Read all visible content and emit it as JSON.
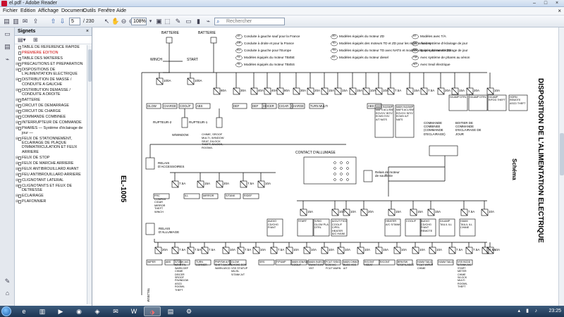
{
  "window": {
    "title": "el.pdf - Adobe Reader",
    "buttons": [
      "–",
      "□",
      "×"
    ]
  },
  "menu": {
    "items": [
      "Fichier",
      "Edition",
      "Affichage",
      "Document",
      "Outils",
      "Fenêtre",
      "Aide"
    ],
    "close": "×"
  },
  "toolbar": {
    "page_current": "5",
    "page_total": "/ 230",
    "zoom": "108%",
    "search_placeholder": "Rechercher"
  },
  "signets": {
    "title": "Signets",
    "close": "×",
    "items": [
      {
        "label": "TABLE DE REFERENCE RAPIDE",
        "selected": false,
        "expandable": false
      },
      {
        "label": "PREMIERE EDITION",
        "selected": true,
        "expandable": false
      },
      {
        "label": "TABLE DES MATIERES",
        "selected": false,
        "expandable": false
      },
      {
        "label": "PRECAUTIONS ET PREPARATION",
        "selected": false,
        "expandable": true
      },
      {
        "label": "DISPOSITIONS DE L'ALIMENTATION ELECTRIQUE",
        "selected": false,
        "expandable": true
      },
      {
        "label": "DISTRIBUTION DE MASSE / CONDUITE A GAUCHE",
        "selected": false,
        "expandable": true
      },
      {
        "label": "DISTRIBUTION DEMASSE / CONDUITE A DROITE",
        "selected": false,
        "expandable": true
      },
      {
        "label": "BATTERIE",
        "selected": false,
        "expandable": true
      },
      {
        "label": "CIRCUIT DE DEMARRAGE",
        "selected": false,
        "expandable": true
      },
      {
        "label": "CIRCUIT DE CHARGE",
        "selected": false,
        "expandable": true
      },
      {
        "label": "COMMANDE COMBINEE",
        "selected": false,
        "expandable": true
      },
      {
        "label": "INTERRUPTEUR DE COMMANDE",
        "selected": false,
        "expandable": true
      },
      {
        "label": "PHARES — Système d'éclairage de jour —",
        "selected": false,
        "expandable": true
      },
      {
        "label": "FEUX DE STATIONNEMENT, ECLAIRAGE DE PLAQUE D'IMMATRICULATION ET FEUX ARRIERE",
        "selected": false,
        "expandable": true
      },
      {
        "label": "FEUX DE STOP",
        "selected": false,
        "expandable": true
      },
      {
        "label": "FEUX DE MARCHE ARRIERE",
        "selected": false,
        "expandable": true
      },
      {
        "label": "FEUX ANTIBROUILLARD AVANT",
        "selected": false,
        "expandable": true
      },
      {
        "label": "FEU ANTIBROUILLARD ARRIERE",
        "selected": false,
        "expandable": true
      },
      {
        "label": "CLIGNOTANT LATERAL",
        "selected": false,
        "expandable": true
      },
      {
        "label": "CLIGNOTANTS ET FEUX DE DETRESSE",
        "selected": false,
        "expandable": true
      },
      {
        "label": "ECLAIRAGE",
        "selected": false,
        "expandable": true
      },
      {
        "label": "PLAFONNIER",
        "selected": false,
        "expandable": true
      }
    ]
  },
  "diagram": {
    "page_code": "EL-1005",
    "vertical_title": "DISPOSITION DE L'ALIMENTATION ELECTRIQUE",
    "vertical_subtitle": "Schéma",
    "small_code": "TEL201M",
    "battery_labels": [
      "BATTERIE",
      "BATTERIE"
    ],
    "winch": "WINCH",
    "start": "START",
    "legend": [
      {
        "code": "LE",
        "text": "Conduite à gauche sauf pour la France"
      },
      {
        "code": "DR",
        "text": "Conduite à droite et pour la France"
      },
      {
        "code": "EU",
        "text": "Conduite à gauche pour l'Europe"
      },
      {
        "code": "T4",
        "text": "Modèles équipés du moteur TB45E"
      },
      {
        "code": "T5",
        "text": "Modèles équipés du moteur TB45S"
      },
      {
        "code": "ZD",
        "text": "Modèles équipés du moteur ZD"
      },
      {
        "code": "TD",
        "text": "Modèles équipés des moteurs TD et ZD pour les régions froides"
      },
      {
        "code": "TN",
        "text": "Modèles équipés du moteur TD avec NATS et modèles équipés du moteur ZD"
      },
      {
        "code": "DI",
        "text": "Modèles équipés du moteur diesel"
      },
      {
        "code": "AT",
        "text": "Modèles avec T/A"
      },
      {
        "code": "DY",
        "text": "Avec système d'éclairage de jour"
      },
      {
        "code": "DN",
        "text": "Sans système d'éclairage de jour"
      },
      {
        "code": "HW",
        "text": "Avec système de phares au xénon"
      },
      {
        "code": "WT",
        "text": "Avec treuil électrique"
      }
    ],
    "top_fuses": [
      "100A",
      "100A",
      "80A",
      "30A",
      "40A",
      "40A",
      "80A",
      "30A",
      "20A",
      "15A",
      "15A",
      "15A",
      "10A",
      "10A",
      "7.5A",
      "15A",
      "7.5A",
      "20A",
      "15A",
      "20A",
      "10A"
    ],
    "top_labels": [
      "GLOW",
      "CHARGE",
      "COOL/F",
      "ABS",
      "DEF",
      "DEF",
      "DEICER",
      "CIGAR",
      "CHARGE",
      "TURN MULTI",
      "ABS"
    ],
    "relays": [
      "RUPTEUR-2",
      "RUPTEUR-1",
      "RELAIS D'ACCESSOIRES",
      "CONTACT D'ALLUMAGE",
      "Relais de moteur de soufflerie",
      "RELAIS D'ALLUMAGE",
      "COMMANDE COMBINEE (COMMANDE D'ECLAIRAGE)",
      "BOITIER DE COMMANDE D'ECLAIRAGE DE JOUR"
    ],
    "mid_fuses": [
      "7.5A",
      "15A",
      "20A",
      "7.5A",
      "10A",
      "15A",
      "10A",
      "10A",
      "20A",
      "15A",
      "15A",
      "15A",
      "7.5A",
      "10A"
    ],
    "mid_labels": [
      "FRC COMPAS CIGAR MIRROR THEFT WINCH",
      "ILL",
      "MIRROR",
      "S/TANK",
      "R/DEF",
      "AUDIO CD/CHG P/ANT",
      "START",
      "S/SIG GLOW PLA DTRL",
      "A/CUT FICD COOL/F C/PEL HEATER A/C H/AIM",
      "HEATER A/C S/TANK",
      "COOL/F",
      "AUDIO CD/CHG P/ANT REMOTE",
      "D/LAMP TAIL/L ILL",
      "H/AIM TAIL/L ILL CHIME"
    ],
    "bottom_fuses": [
      "20A",
      "7.5A",
      "7.5A",
      "7.5A",
      "10A",
      "7.5A",
      "10A",
      "7.5A",
      "10A",
      "10A",
      "10A",
      "10A",
      "10A",
      "15A",
      "10A",
      "10A",
      "10A",
      "7.5A",
      "7.5A",
      "7.5A",
      "10A"
    ],
    "bottom_labels": [
      "WIPER",
      "ABS",
      "S/TANK A/C A/T DTRL WARN DEF CHIME DEICER SROOF P/WINDOW ASCD ROOM/L THEFT",
      "TURN CORNER",
      "PNP/SW A/T SHIFT BACK/L WARN ASCD",
      "GLOW CHOKE ECM VSS ST/ATUP MIL/SL S/TANK A/T",
      "SRS",
      "F/PUMP",
      "MAIN IGN/SIG COOL/F",
      "MAIN INJECT SW/A/T EXV VNT",
      "FCUT S/SIG ECM A/C FCUT WARN",
      "MAIN CHMLY BUSS VSS A/T",
      "R/CONT HSEAT",
      "R/CONT",
      "BRK/SW STOP/L ASCD",
      "H/AIM TAIL/L FCUT WIPER CHIME",
      "H/AIM TAIL/L",
      "VSS BCDD S/TANK A/C START METER CHIME S/LOCK MULTI ROOM/L THEFT"
    ],
    "top_right_boxes": [
      "MAIN INJ/AMP MAFS ACL/SW EGVC/V INT/V ECM/V EXV A/T NATS",
      "MAIN INJ/AMP MAFS ACL/SW EGVC/V INT/V ECM/V A/T NATS",
      "H/LAMP DTRL",
      "H/LAMP DTRL",
      "H/LAMP R/FOG THEFT",
      "HORN REMOTE ASCD THEFT"
    ],
    "wiper_text": "W/WINDOW",
    "chime_text": "CHIME, SROOF MULTI, WINDOW SEAT, D/LOCK THEFT, S/LOCK, ROOM/L"
  }
}
